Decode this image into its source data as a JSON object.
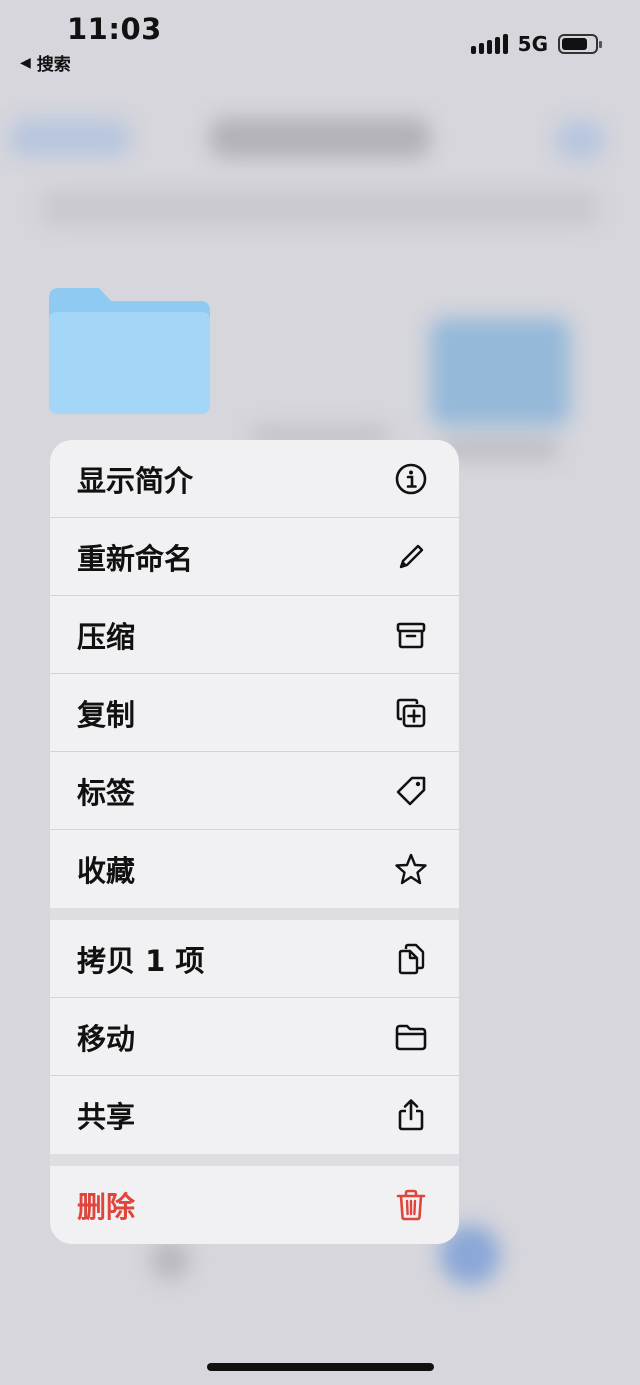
{
  "status_bar": {
    "time": "11:03",
    "back_label": "搜索",
    "network": "5G"
  },
  "menu": {
    "groups": [
      [
        {
          "label": "显示简介",
          "icon": "info-icon"
        },
        {
          "label": "重新命名",
          "icon": "pencil-icon"
        },
        {
          "label": "压缩",
          "icon": "archive-box-icon"
        },
        {
          "label": "复制",
          "icon": "duplicate-icon"
        },
        {
          "label": "标签",
          "icon": "tag-icon"
        },
        {
          "label": "收藏",
          "icon": "star-icon"
        }
      ],
      [
        {
          "label": "拷贝 1 项",
          "icon": "copy-docs-icon"
        },
        {
          "label": "移动",
          "icon": "folder-icon"
        },
        {
          "label": "共享",
          "icon": "share-icon"
        }
      ],
      [
        {
          "label": "删除",
          "icon": "trash-icon",
          "destructive": true
        }
      ]
    ]
  },
  "colors": {
    "destructive": "#e0443a",
    "folder": "#8fcaf2",
    "background": "#d6d6dc",
    "menu_background": "#f1f1f3"
  }
}
